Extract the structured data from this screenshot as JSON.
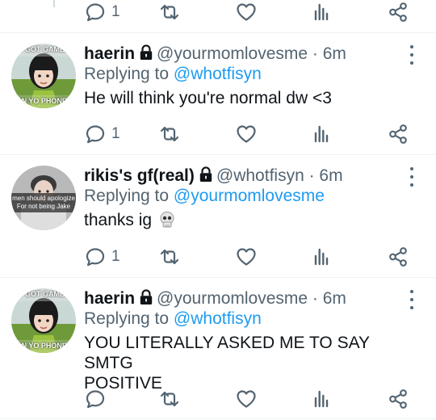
{
  "top_actions": {
    "reply_count": "1"
  },
  "tweets": [
    {
      "display_name": "haerin",
      "handle": "@yourmomlovesme",
      "time": "6m",
      "replying_prefix": "Replying to",
      "replying_to": "@whotfisyn",
      "text": "He will think you're normal dw <3",
      "reply_count": "1",
      "avatar_caption_top": "U GOT GAMES",
      "avatar_caption_bottom": "ON YO PHONE?"
    },
    {
      "display_name": "rikis's gf(real)",
      "handle": "@whotfisyn",
      "time": "6m",
      "replying_prefix": "Replying to",
      "replying_to": "@yourmomlovesme",
      "text": "thanks ig",
      "reply_count": "1",
      "avatar_caption_line1": "men should apologize",
      "avatar_caption_line2": "For not being Jake"
    },
    {
      "display_name": "haerin",
      "handle": "@yourmomlovesme",
      "time": "6m",
      "replying_prefix": "Replying to",
      "replying_to": "@whotfisyn",
      "text_line1": "YOU LITERALLY ASKED ME TO SAY SMTG",
      "text_line2": "POSITIVE",
      "reply_count": "",
      "avatar_caption_top": "U GOT GAMES",
      "avatar_caption_bottom": "ON YO PHONE?"
    }
  ],
  "icons": {
    "reply": "speech-bubble-icon",
    "retweet": "retweet-arrows-icon",
    "like": "heart-outline-icon",
    "stats": "bar-chart-icon",
    "share": "share-nodes-icon",
    "more": "vertical-ellipsis-icon",
    "lock": "padlock-icon",
    "emoji": "skull-emoji"
  },
  "colors": {
    "mention": "#1d9bf0",
    "secondary_text": "#536471",
    "primary_text": "#0f1419"
  }
}
